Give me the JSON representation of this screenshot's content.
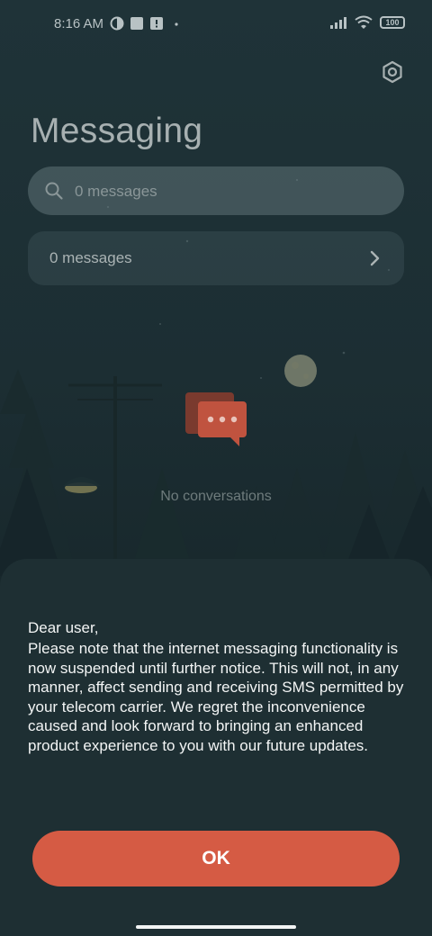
{
  "status_bar": {
    "time": "8:16 AM",
    "battery": "100",
    "icons": [
      "data-saver-icon",
      "notification-square-icon",
      "sim-alert-icon",
      "dot-icon",
      "signal-icon",
      "wifi-icon",
      "battery-icon"
    ]
  },
  "header": {
    "title": "Messaging",
    "settings_icon": "gear-icon"
  },
  "search": {
    "placeholder": "0 messages",
    "icon": "search-icon"
  },
  "messages_row": {
    "label": "0 messages",
    "icon": "chevron-right-icon"
  },
  "empty_state": {
    "icon": "chat-bubbles-icon",
    "text": "No conversations"
  },
  "dialog": {
    "greeting": "Dear user,",
    "body": "Please note that the internet messaging functionality is now suspended until further notice. This will not, in any manner, affect sending and receiving SMS permitted by your telecom carrier. We regret the inconvenience caused and look forward to bringing an enhanced product experience to you with our future updates.",
    "ok_label": "OK"
  },
  "colors": {
    "background": "#1f3338",
    "sheet": "#1e2f33",
    "accent": "#d55b44",
    "text_primary": "#f3f5f5",
    "text_muted": "#6e7b7c"
  }
}
